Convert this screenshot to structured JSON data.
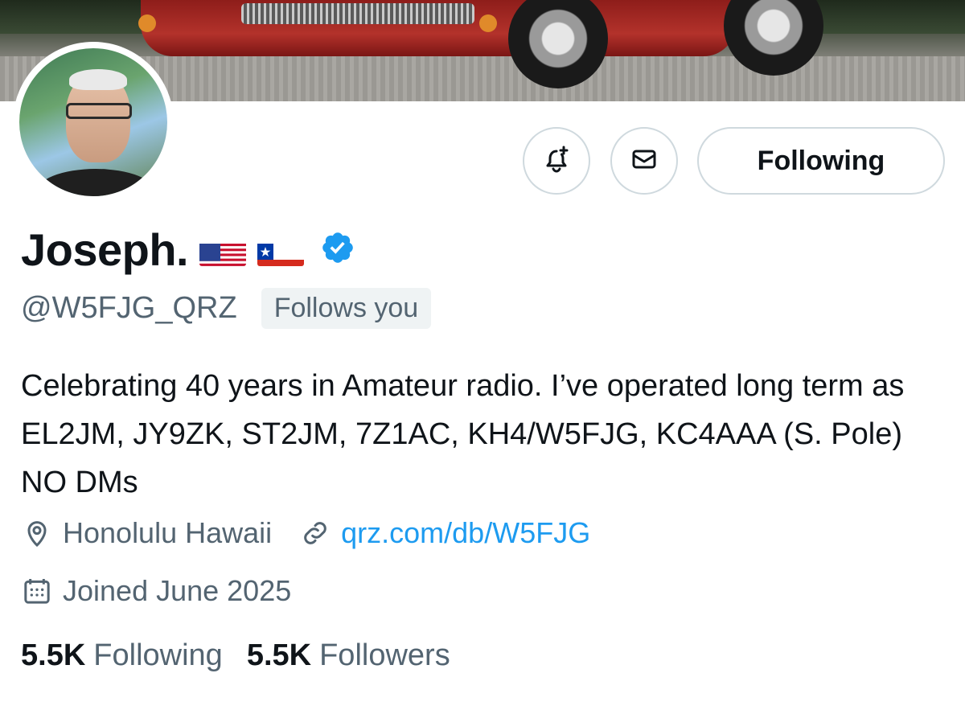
{
  "banner": {
    "description_icon": "car-banner-image"
  },
  "profile": {
    "name": "Joseph.",
    "flags": [
      "us-flag",
      "chile-flag"
    ],
    "verified_icon": "verified-badge-icon",
    "handle": "@W5FJG_QRZ",
    "follows_you": "Follows you",
    "bio": "Celebrating 40 years in Amateur radio. I’ve operated long term as EL2JM, JY9ZK, ST2JM, 7Z1AC, KH4/W5FJG, KC4AAA (S. Pole) NO DMs",
    "location": "Honolulu Hawaii",
    "website": "qrz.com/db/W5FJG",
    "joined": "Joined June 2025"
  },
  "actions": {
    "notify_icon": "bell-plus-icon",
    "message_icon": "envelope-icon",
    "follow_label": "Following"
  },
  "stats": {
    "following_count": "5.5K",
    "following_label": "Following",
    "followers_count": "5.5K",
    "followers_label": "Followers"
  },
  "colors": {
    "accent": "#1d9bf0",
    "text": "#0f1419",
    "secondary": "#536471",
    "border": "#cfd9de"
  }
}
